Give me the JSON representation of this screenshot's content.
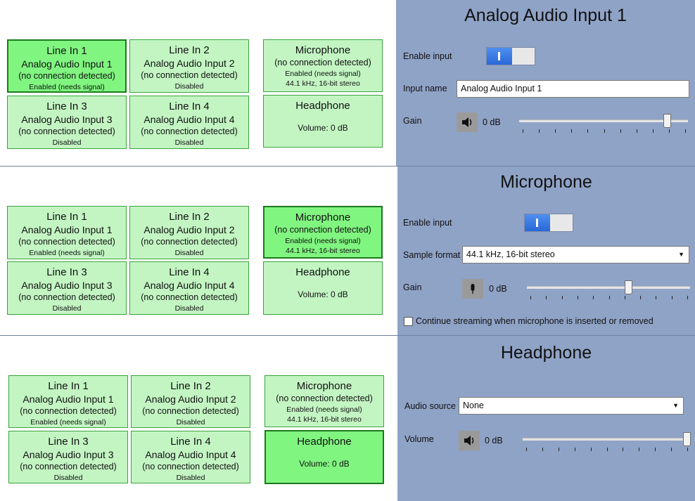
{
  "tiles": {
    "line_in_1": {
      "name": "Line In 1",
      "input": "Analog Audio Input 1",
      "conn": "(no connection detected)",
      "status": "Enabled (needs signal)"
    },
    "line_in_2": {
      "name": "Line In 2",
      "input": "Analog Audio Input 2",
      "conn": "(no connection detected)",
      "status": "Disabled"
    },
    "line_in_3": {
      "name": "Line In 3",
      "input": "Analog Audio Input 3",
      "conn": "(no connection detected)",
      "status": "Disabled"
    },
    "line_in_4": {
      "name": "Line In 4",
      "input": "Analog Audio Input 4",
      "conn": "(no connection detected)",
      "status": "Disabled"
    },
    "microphone": {
      "name": "Microphone",
      "conn": "(no connection detected)",
      "status": "Enabled (needs signal)",
      "format": "44.1 kHz, 16-bit stereo"
    },
    "headphone": {
      "name": "Headphone",
      "volume": "Volume: 0 dB"
    }
  },
  "panel_line": {
    "title": "Analog Audio Input 1",
    "enable_label": "Enable input",
    "enabled": true,
    "name_label": "Input name",
    "name_value": "Analog Audio Input 1",
    "gain_label": "Gain",
    "gain_value": "0 dB",
    "gain_level": 0.9
  },
  "panel_mic": {
    "title": "Microphone",
    "enable_label": "Enable input",
    "enabled": true,
    "format_label": "Sample format",
    "format_value": "44.1 kHz, 16-bit stereo",
    "gain_label": "Gain",
    "gain_value": "0 dB",
    "gain_level": 0.63,
    "continue_label": "Continue streaming when microphone is inserted or removed",
    "continue_checked": false
  },
  "panel_headphone": {
    "title": "Headphone",
    "source_label": "Audio source",
    "source_value": "None",
    "volume_label": "Volume",
    "volume_value": "0 dB",
    "volume_level": 1.0
  },
  "colors": {
    "tile": "#c3f5c3",
    "tile_selected": "#80f580",
    "panel": "#8fa3c6",
    "toggle_on": "#2a68d8"
  },
  "icons": {
    "speaker": "speaker-icon",
    "microphone": "microphone-icon"
  }
}
